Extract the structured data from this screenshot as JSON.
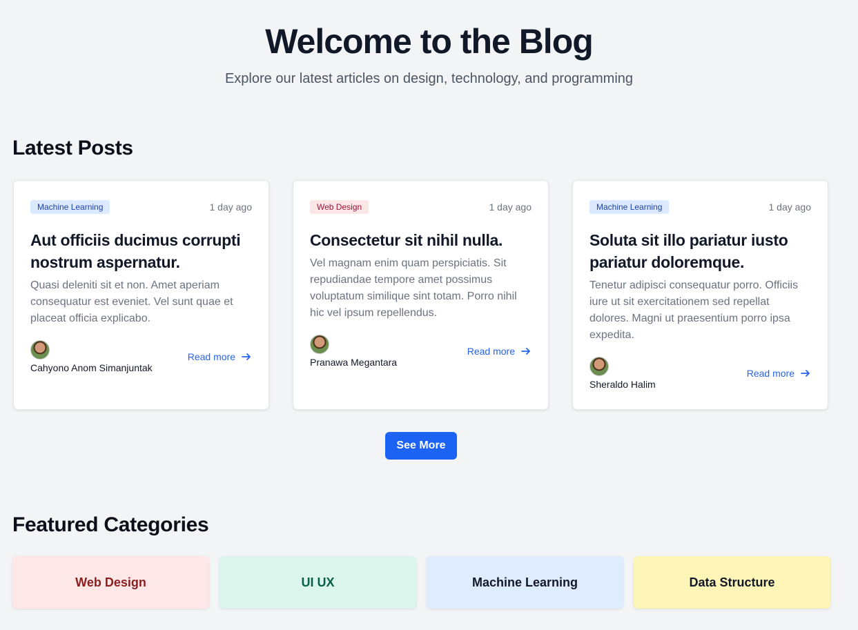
{
  "hero": {
    "title": "Welcome to the Blog",
    "subtitle": "Explore our latest articles on design, technology, and programming"
  },
  "latest": {
    "title": "Latest Posts",
    "posts": [
      {
        "category": "Machine Learning",
        "date": "1 day ago",
        "title": "Aut officiis ducimus corrupti nostrum aspernatur.",
        "excerpt": "Quasi deleniti sit et non. Amet aperiam consequatur est eveniet. Vel sunt quae et placeat officia explicabo.",
        "author": "Cahyono Anom Simanjuntak",
        "read_more": "Read more"
      },
      {
        "category": "Web Design",
        "date": "1 day ago",
        "title": "Consectetur sit nihil nulla.",
        "excerpt": "Vel magnam enim quam perspiciatis. Sit repudiandae tempore amet possimus voluptatum similique sint totam. Porro nihil hic vel ipsum repellendus.",
        "author": "Pranawa Megantara",
        "read_more": "Read more"
      },
      {
        "category": "Machine Learning",
        "date": "1 day ago",
        "title": "Soluta sit illo pariatur iusto pariatur doloremque.",
        "excerpt": "Tenetur adipisci consequatur porro. Officiis iure ut sit exercitationem sed repellat dolores. Magni ut praesentium porro ipsa expedita.",
        "author": "Sheraldo Halim",
        "read_more": "Read more"
      }
    ],
    "see_more": "See More"
  },
  "featured": {
    "title": "Featured Categories",
    "categories": [
      "Web Design",
      "UI UX",
      "Machine Learning",
      "Data Structure"
    ]
  },
  "icons": {
    "read_more": "arrow-right-icon",
    "avatar": "user-avatar"
  },
  "colors": {
    "accent": "#1d63f3",
    "link": "#2563eb"
  }
}
